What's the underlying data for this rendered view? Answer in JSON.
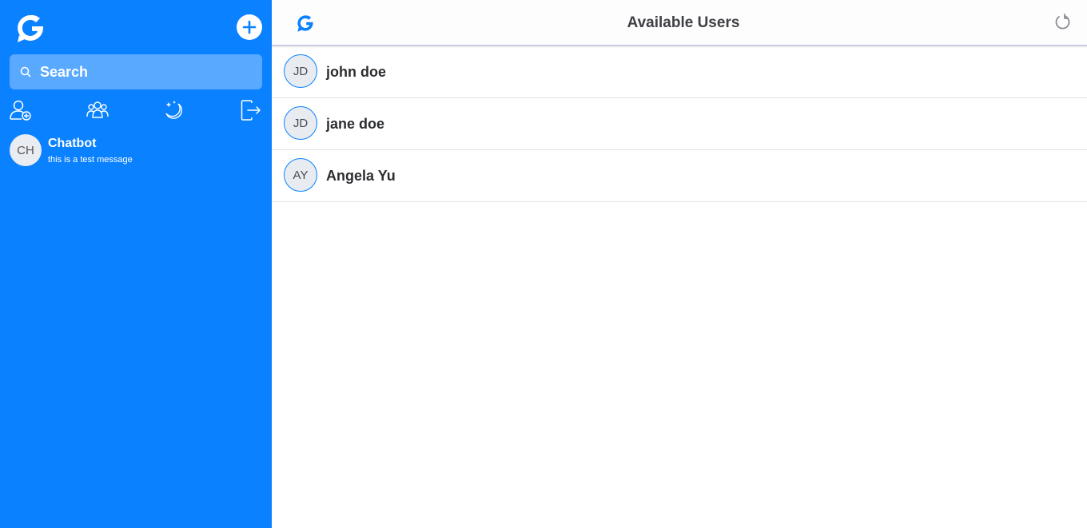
{
  "sidebar": {
    "search_label": "Search",
    "icons": [
      "add-user-icon",
      "group-icon",
      "theme-icon",
      "logout-icon"
    ],
    "chats": [
      {
        "initials": "CH",
        "name": "Chatbot",
        "message": "this is a test message"
      }
    ]
  },
  "header": {
    "title": "Available Users"
  },
  "users": [
    {
      "initials": "JD",
      "name": "john doe"
    },
    {
      "initials": "JD",
      "name": "jane doe"
    },
    {
      "initials": "AY",
      "name": "Angela Yu"
    }
  ],
  "colors": {
    "accent": "#0a81ff",
    "sidebar_bg": "#0a81ff",
    "avatar_bg": "#e8ecf1"
  }
}
